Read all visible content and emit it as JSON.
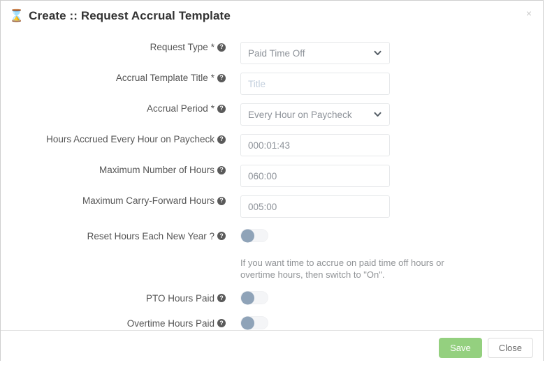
{
  "header": {
    "icon": "hourglass-icon",
    "title": "Create :: Request Accrual Template",
    "close_icon": "×"
  },
  "form": {
    "rows": [
      {
        "label": "Request Type",
        "required": true,
        "star": "*",
        "help": "?",
        "control": "select",
        "value": "Paid Time Off"
      },
      {
        "label": "Accrual Template Title",
        "required": true,
        "star": "*",
        "help": "?",
        "control": "text",
        "value": "",
        "placeholder": "Title"
      },
      {
        "label": "Accrual Period",
        "required": true,
        "star": "*",
        "help": "?",
        "control": "select",
        "value": "Every Hour on Paycheck"
      },
      {
        "label": "Hours Accrued Every Hour on Paycheck",
        "required": false,
        "help": "?",
        "control": "text",
        "value": "000:01:43"
      },
      {
        "label": "Maximum Number of Hours",
        "required": false,
        "help": "?",
        "control": "text",
        "value": "060:00"
      },
      {
        "label": "Maximum Carry-Forward Hours",
        "required": false,
        "help": "?",
        "control": "text",
        "value": "005:00"
      },
      {
        "label": "Reset Hours Each New Year ?",
        "required": false,
        "help": "?",
        "control": "toggle",
        "state": "off"
      },
      {
        "label": "PTO Hours Paid",
        "required": false,
        "help": "?",
        "control": "toggle",
        "state": "off"
      },
      {
        "label": "Overtime Hours Paid",
        "required": false,
        "help": "?",
        "control": "toggle",
        "state": "off"
      }
    ],
    "helper_text": "If you want time to accrue on paid time off hours or overtime hours, then switch to \"On\"."
  },
  "footer": {
    "save_label": "Save",
    "close_label": "Close"
  },
  "colors": {
    "save_green": "#94d07f",
    "toggle_knob": "#8fa3b8",
    "toggle_track": "#f4f5f7",
    "label_text": "#555555",
    "value_text": "#8d9299",
    "placeholder_text": "#c3cfdd"
  }
}
